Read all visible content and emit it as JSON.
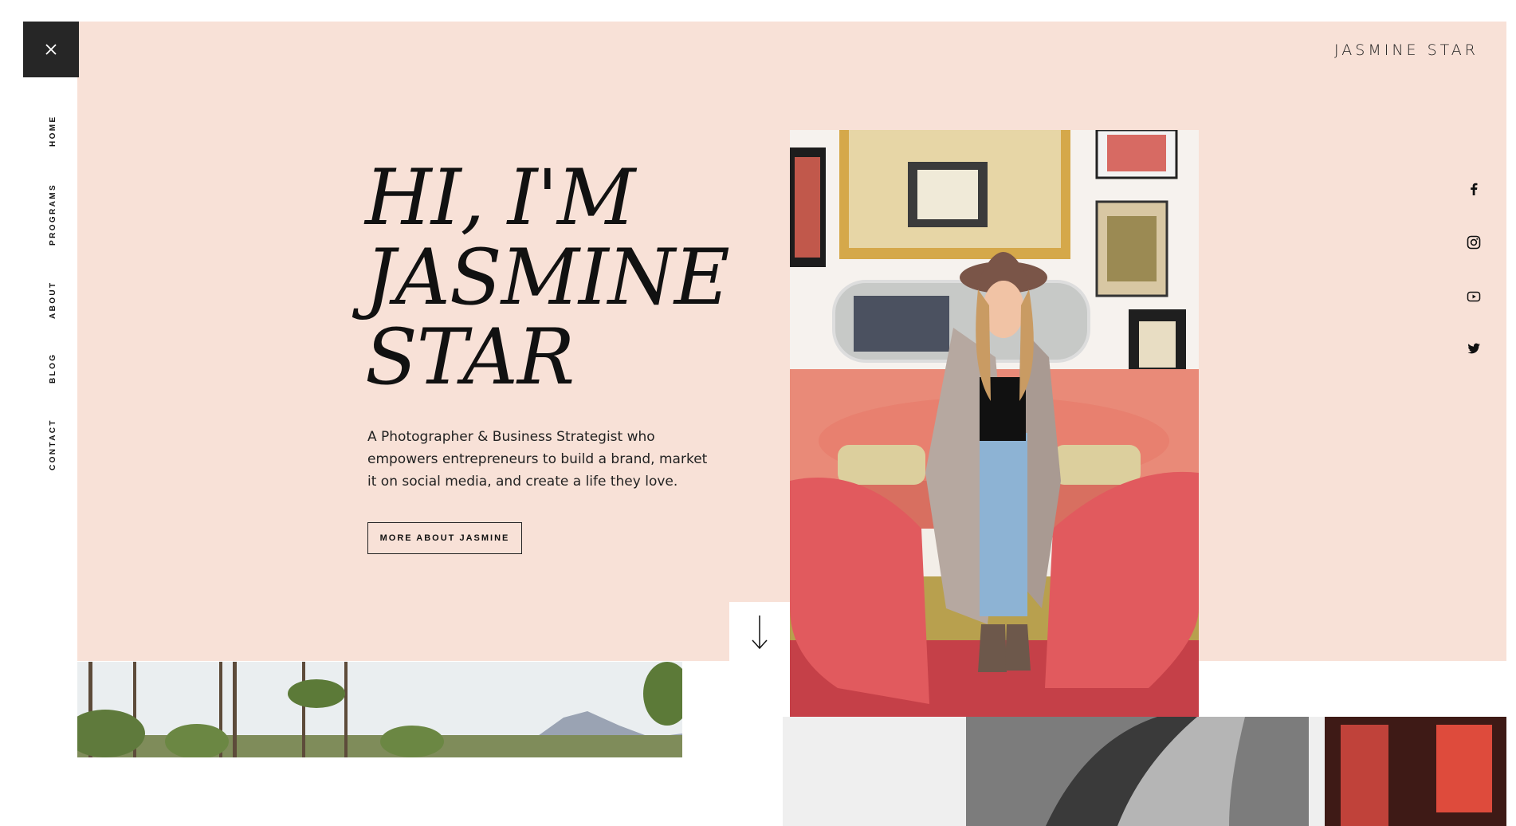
{
  "brand": {
    "name": "JASMINE STAR"
  },
  "nav": {
    "close_icon": "close-icon",
    "items": [
      {
        "label": "HOME"
      },
      {
        "label": "PROGRAMS"
      },
      {
        "label": "ABOUT"
      },
      {
        "label": "BLOG"
      },
      {
        "label": "CONTACT"
      }
    ]
  },
  "hero": {
    "headline_lines": [
      "HI, I'M",
      "JASMINE",
      "STAR"
    ],
    "intro": "A Photographer & Business Strategist who empowers entrepreneurs to build a brand, market it on social media, and create a life they love.",
    "cta_label": "MORE ABOUT JASMINE",
    "scroll_icon": "arrow-down-icon"
  },
  "social": [
    {
      "icon": "facebook-icon"
    },
    {
      "icon": "instagram-icon"
    },
    {
      "icon": "youtube-icon"
    },
    {
      "icon": "twitter-icon"
    }
  ],
  "colors": {
    "hero_bg": "#f8e1d7",
    "close_bg": "#262626",
    "text": "#111111"
  }
}
